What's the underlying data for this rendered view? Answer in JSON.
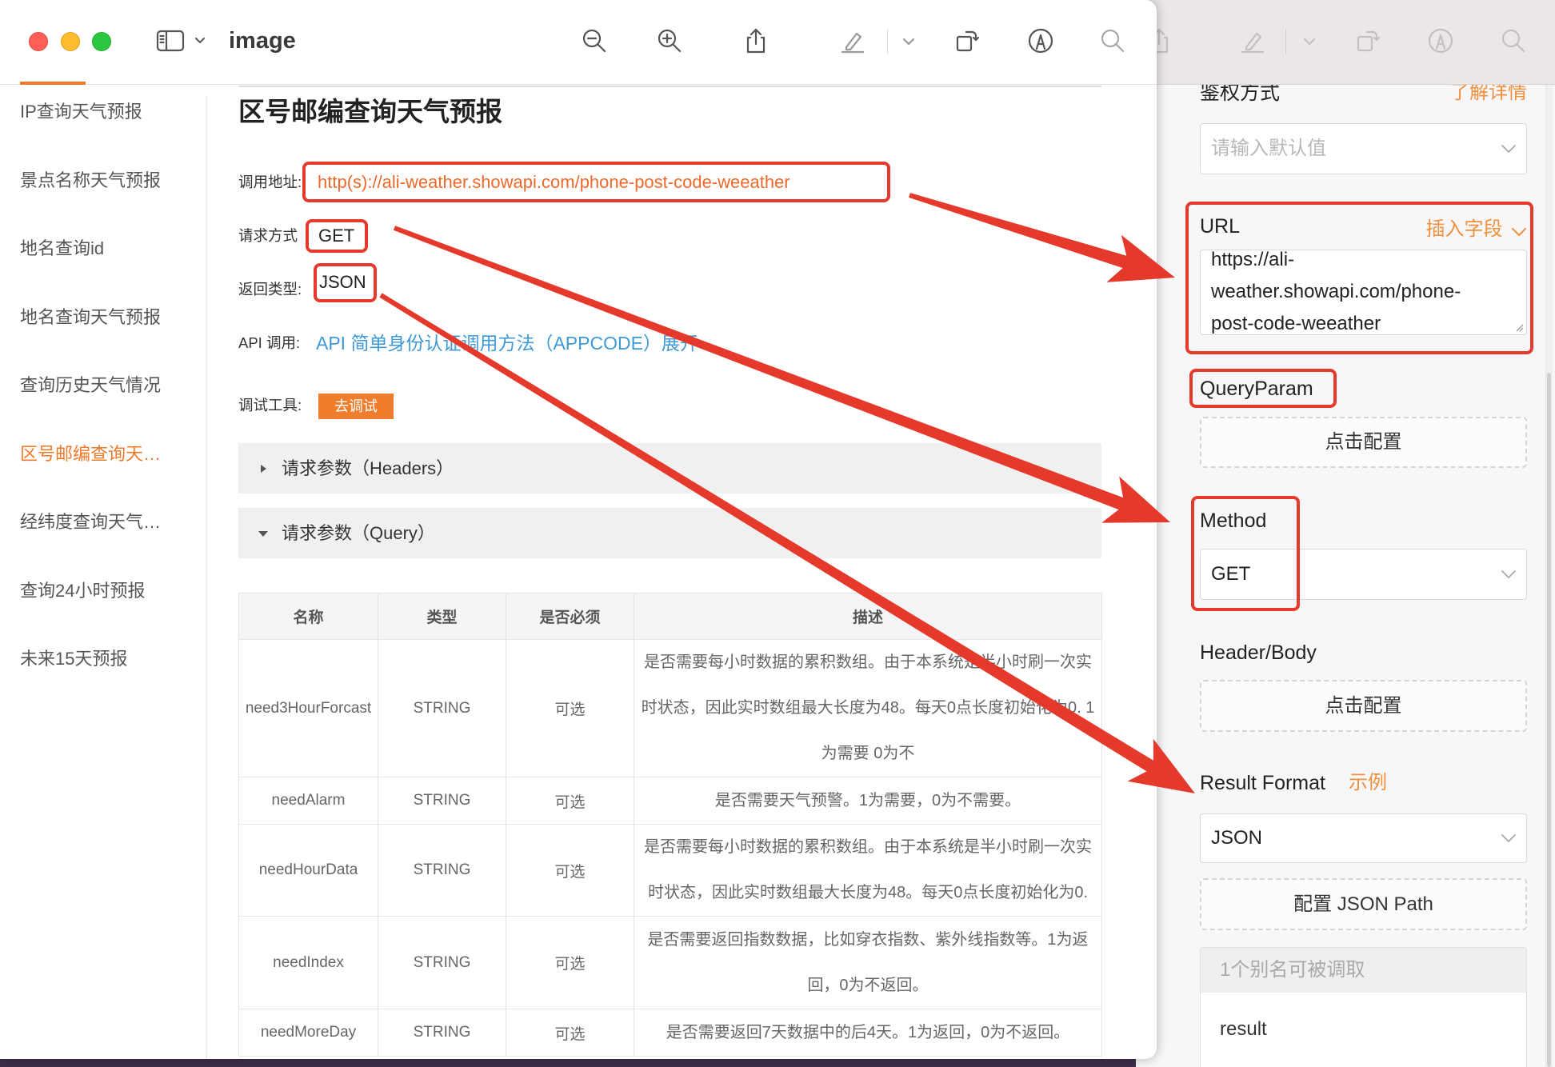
{
  "window": {
    "title": "image"
  },
  "colors": {
    "accent_orange": "#f07a2a",
    "link_blue": "#3d9ad6",
    "annotation_red": "#e5392c",
    "close_light": "#fe5f57",
    "minimize_light": "#febb2e",
    "zoom_light": "#29c840"
  },
  "toolbar": {
    "icons": [
      "sidebar-toggle-icon",
      "chevron-down-icon",
      "zoom-out-icon",
      "zoom-in-icon",
      "share-icon",
      "highlight-pen-icon",
      "chevron-down-icon",
      "rotate-icon",
      "markup-icon",
      "search-icon"
    ]
  },
  "sidebar": {
    "items": [
      {
        "label": "IP查询天气预报",
        "active": false
      },
      {
        "label": "景点名称天气预报",
        "active": false
      },
      {
        "label": "地名查询id",
        "active": false
      },
      {
        "label": "地名查询天气预报",
        "active": false
      },
      {
        "label": "查询历史天气情况",
        "active": false
      },
      {
        "label": "区号邮编查询天…",
        "active": true
      },
      {
        "label": "经纬度查询天气…",
        "active": false
      },
      {
        "label": "查询24小时预报",
        "active": false
      },
      {
        "label": "未来15天预报",
        "active": false
      }
    ]
  },
  "main": {
    "heading": "区号邮编查询天气预报",
    "call_address": {
      "label": "调用地址:",
      "value": "http(s)://ali-weather.showapi.com/phone-post-code-weeather"
    },
    "request_method": {
      "label": "请求方式",
      "value": "GET"
    },
    "return_type": {
      "label": "返回类型:",
      "value": "JSON"
    },
    "api_call": {
      "label": "API 调用:",
      "link": "API 简单身份认证调用方法（APPCODE）展开"
    },
    "debug_tool": {
      "label": "调试工具:",
      "button": "去调试"
    },
    "sections": [
      {
        "label": "请求参数（Headers）",
        "expanded": false
      },
      {
        "label": "请求参数（Query）",
        "expanded": true
      }
    ],
    "table": {
      "columns": [
        "名称",
        "类型",
        "是否必须",
        "描述"
      ],
      "rows": [
        {
          "name": "need3HourForcast",
          "type": "STRING",
          "required": "可选",
          "desc": [
            "是否需要每小时数据的累积数组。由于本系统是半小时刷一次实",
            "时状态，因此实时数组最大长度为48。每天0点长度初始化为0. 1",
            "为需要 0为不"
          ]
        },
        {
          "name": "needAlarm",
          "type": "STRING",
          "required": "可选",
          "desc": [
            "是否需要天气预警。1为需要，0为不需要。"
          ]
        },
        {
          "name": "needHourData",
          "type": "STRING",
          "required": "可选",
          "desc": [
            "是否需要每小时数据的累积数组。由于本系统是半小时刷一次实",
            "时状态，因此实时数组最大长度为48。每天0点长度初始化为0."
          ]
        },
        {
          "name": "needIndex",
          "type": "STRING",
          "required": "可选",
          "desc": [
            "是否需要返回指数数据，比如穿衣指数、紫外线指数等。1为返",
            "回，0为不返回。"
          ]
        },
        {
          "name": "needMoreDay",
          "type": "STRING",
          "required": "可选",
          "desc": [
            "是否需要返回7天数据中的后4天。1为返回，0为不返回。"
          ]
        }
      ]
    }
  },
  "config_panel": {
    "toolbar_icons": [
      "share-icon",
      "highlight-pen-icon",
      "chevron-down-icon",
      "rotate-icon",
      "markup-icon",
      "search-icon"
    ],
    "auth": {
      "label": "鉴权方式",
      "link": "了解详情",
      "placeholder": "请输入默认值"
    },
    "url": {
      "label": "URL",
      "insert_field": "插入字段",
      "value_lines": [
        "https://ali-",
        "weather.showapi.com/phone-",
        "post-code-weeather"
      ]
    },
    "query_param": {
      "label": "QueryParam",
      "button": "点击配置"
    },
    "method": {
      "label": "Method",
      "value": "GET"
    },
    "header_body": {
      "label": "Header/Body",
      "button": "点击配置"
    },
    "result_format": {
      "label": "Result Format",
      "example": "示例",
      "value": "JSON",
      "json_path_button": "配置 JSON Path"
    },
    "alias": {
      "header": "1个别名可被调取",
      "items": [
        "result"
      ]
    }
  }
}
